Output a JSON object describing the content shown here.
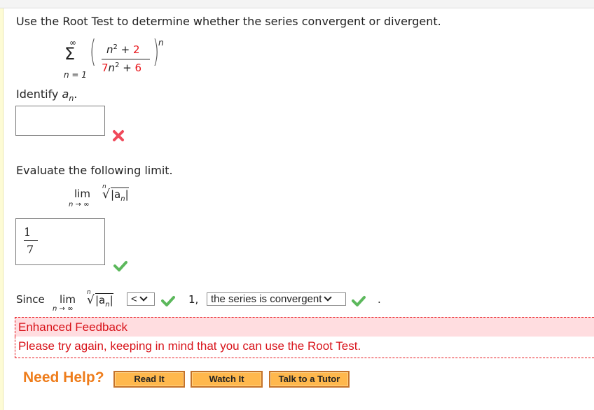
{
  "question": {
    "prompt": "Use the Root Test to determine whether the series convergent or divergent.",
    "series": {
      "sum_symbol": "Σ",
      "upper_limit": "∞",
      "lower_limit": "n = 1",
      "numerator_var": "n",
      "numerator_exp": "2",
      "numerator_op": " + ",
      "numerator_const": "2",
      "denominator_coef": "7",
      "denominator_var": "n",
      "denominator_exp": "2",
      "denominator_op": " + ",
      "denominator_const": "6",
      "outer_exponent": "n",
      "paren_left": "(",
      "paren_right": ")"
    }
  },
  "part1": {
    "label": "Identify",
    "label_var": "a",
    "label_sub": "n",
    "label_end": ".",
    "answer_value": "",
    "status": "incorrect",
    "status_icon": "x-mark-icon"
  },
  "part2": {
    "label": "Evaluate the following limit.",
    "lim": "lim",
    "lim_sub": "n → ∞",
    "root_index": "n",
    "radicand": "|a",
    "radicand_sub": "n",
    "radicand_end": "|",
    "radical": "√",
    "answer_numerator": "1",
    "answer_denominator": "7",
    "status": "correct",
    "status_icon": "check-icon"
  },
  "part3": {
    "since": "Since",
    "lim": "lim",
    "lim_sub": "n → ∞",
    "root_index": "n",
    "radical": "√",
    "radicand": "|a",
    "radicand_sub": "n",
    "radicand_end": "|",
    "comparison_selected": "<",
    "comparison_status": "correct",
    "value": "1,",
    "conclusion_selected": "the series is convergent",
    "conclusion_status": "correct",
    "end": "."
  },
  "feedback": {
    "title": "Enhanced Feedback",
    "message": "Please try again, keeping in mind that you can use the Root Test.",
    "color": "#d8131a",
    "background": "#ffdde0"
  },
  "help": {
    "label": "Need Help?",
    "buttons": [
      "Read It",
      "Watch It",
      "Talk to a Tutor"
    ],
    "accent": "#ee7d1c"
  },
  "colors": {
    "incorrect": "#f0495a",
    "correct": "#5cb85c"
  }
}
